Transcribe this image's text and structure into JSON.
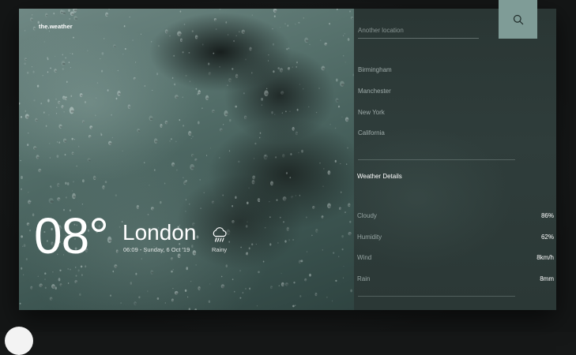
{
  "app": {
    "brand": "the.weather"
  },
  "current": {
    "temperature": "08°",
    "city": "London",
    "datetime": "06:09 - Sunday, 6 Oct '19",
    "condition": "Rainy",
    "condition_icon": "rain-cloud-icon"
  },
  "search": {
    "placeholder": "Another location",
    "value": "",
    "icon": "search-icon"
  },
  "locations": [
    {
      "label": "Birmingham"
    },
    {
      "label": "Manchester"
    },
    {
      "label": "New York"
    },
    {
      "label": "California"
    }
  ],
  "details": {
    "title": "Weather Details",
    "rows": [
      {
        "label": "Cloudy",
        "value": "86%"
      },
      {
        "label": "Humidity",
        "value": "62%"
      },
      {
        "label": "Wind",
        "value": "8km/h"
      },
      {
        "label": "Rain",
        "value": "8mm"
      }
    ]
  },
  "colors": {
    "accent": "#7f9c97",
    "panel_bg": "#2f3d3b",
    "text_primary": "#ffffff",
    "text_muted": "#cddad8"
  }
}
